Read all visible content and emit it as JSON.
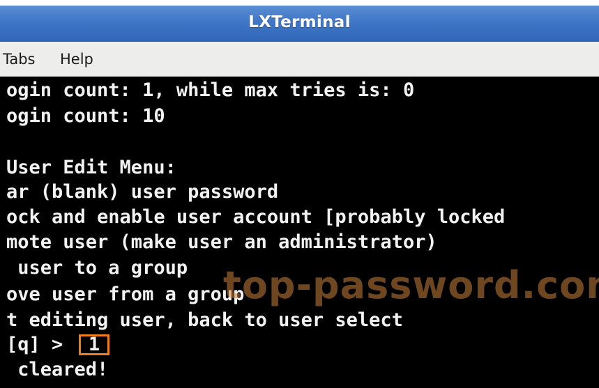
{
  "window": {
    "title": "LXTerminal"
  },
  "menubar": {
    "items": [
      "Tabs",
      "Help"
    ]
  },
  "terminal": {
    "lines": [
      "ogin count: 1, while max tries is: 0",
      "ogin count: 10",
      "",
      "User Edit Menu:",
      "ar (blank) user password",
      "ock and enable user account [probably locked",
      "mote user (make user an administrator)",
      " user to a group",
      "ove user from a group",
      "t editing user, back to user select",
      "[q] > ",
      " cleared!"
    ],
    "input_value": "1",
    "highlight_color": "#ef7d1a"
  },
  "watermark": {
    "text": "top-password.com"
  }
}
